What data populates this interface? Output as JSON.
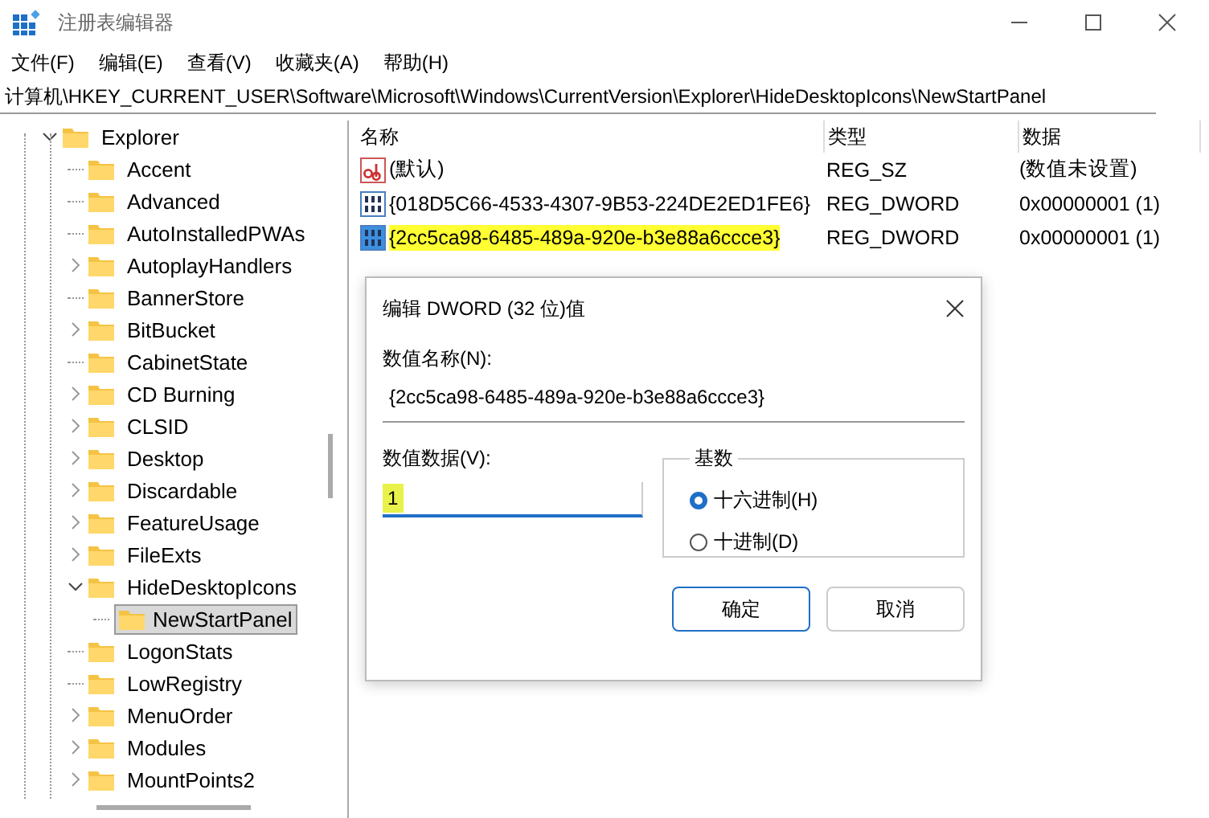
{
  "window": {
    "title": "注册表编辑器"
  },
  "menu": [
    "文件(F)",
    "编辑(E)",
    "查看(V)",
    "收藏夹(A)",
    "帮助(H)"
  ],
  "address": "计算机\\HKEY_CURRENT_USER\\Software\\Microsoft\\Windows\\CurrentVersion\\Explorer\\HideDesktopIcons\\NewStartPanel",
  "tree": [
    {
      "label": "Explorer",
      "expanded": true,
      "selected": false,
      "children": [
        {
          "label": "Accent",
          "expandable": false,
          "selected": false
        },
        {
          "label": "Advanced",
          "expandable": false,
          "selected": false
        },
        {
          "label": "AutoInstalledPWAs",
          "expandable": false,
          "selected": false
        },
        {
          "label": "AutoplayHandlers",
          "expandable": true,
          "expanded": false,
          "selected": false
        },
        {
          "label": "BannerStore",
          "expandable": false,
          "selected": false
        },
        {
          "label": "BitBucket",
          "expandable": true,
          "expanded": false,
          "selected": false
        },
        {
          "label": "CabinetState",
          "expandable": false,
          "selected": false
        },
        {
          "label": "CD Burning",
          "expandable": true,
          "expanded": false,
          "selected": false
        },
        {
          "label": "CLSID",
          "expandable": true,
          "expanded": false,
          "selected": false
        },
        {
          "label": "Desktop",
          "expandable": true,
          "expanded": false,
          "selected": false
        },
        {
          "label": "Discardable",
          "expandable": true,
          "expanded": false,
          "selected": false
        },
        {
          "label": "FeatureUsage",
          "expandable": true,
          "expanded": false,
          "selected": false
        },
        {
          "label": "FileExts",
          "expandable": true,
          "expanded": false,
          "selected": false
        },
        {
          "label": "HideDesktopIcons",
          "expandable": true,
          "expanded": true,
          "selected": false,
          "children": [
            {
              "label": "NewStartPanel",
              "selected": true
            }
          ]
        },
        {
          "label": "LogonStats",
          "expandable": false,
          "selected": false
        },
        {
          "label": "LowRegistry",
          "expandable": false,
          "selected": false
        },
        {
          "label": "MenuOrder",
          "expandable": true,
          "expanded": false,
          "selected": false
        },
        {
          "label": "Modules",
          "expandable": true,
          "expanded": false,
          "selected": false
        },
        {
          "label": "MountPoints2",
          "expandable": true,
          "expanded": false,
          "selected": false
        }
      ]
    }
  ],
  "values": {
    "columns": [
      "名称",
      "类型",
      "数据"
    ],
    "rows": [
      {
        "kind": "string",
        "name": "(默认)",
        "type": "REG_SZ",
        "data": "(数值未设置)",
        "selected": false,
        "highlighted": false
      },
      {
        "kind": "binary",
        "name": "{018D5C66-4533-4307-9B53-224DE2ED1FE6}",
        "type": "REG_DWORD",
        "data": "0x00000001 (1)",
        "selected": false,
        "highlighted": false
      },
      {
        "kind": "binary",
        "name": "{2cc5ca98-6485-489a-920e-b3e88a6ccce3}",
        "type": "REG_DWORD",
        "data": "0x00000001 (1)",
        "selected": true,
        "highlighted": true
      }
    ]
  },
  "dialog": {
    "title": "编辑 DWORD (32 位)值",
    "name_label": "数值名称(N):",
    "name_value": "{2cc5ca98-6485-489a-920e-b3e88a6ccce3}",
    "data_label": "数值数据(V):",
    "data_value": "1",
    "data_highlighted": true,
    "base_group": "基数",
    "bases": [
      {
        "label": "十六进制(H)",
        "selected": true
      },
      {
        "label": "十进制(D)",
        "selected": false
      }
    ],
    "buttons": [
      {
        "label": "确定",
        "default": true
      },
      {
        "label": "取消",
        "default": false
      }
    ]
  }
}
